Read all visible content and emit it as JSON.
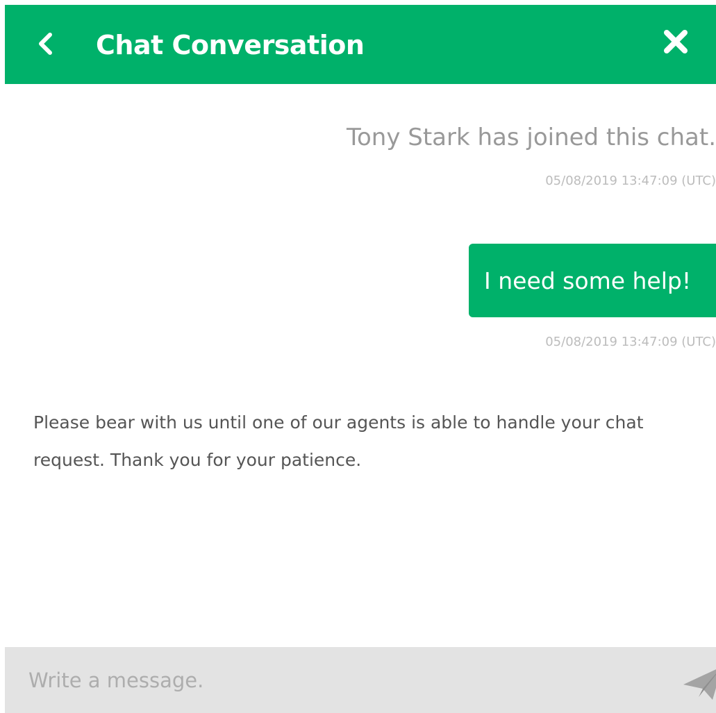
{
  "theme": {
    "accent": "#00b16a",
    "composer_bg": "#e3e3e3",
    "muted_text": "#999999"
  },
  "header": {
    "title": "Chat Conversation",
    "back_icon": "chevron-left-icon",
    "close_icon": "close-icon"
  },
  "messages": [
    {
      "type": "system",
      "text": "Tony Stark has joined this chat.",
      "timestamp": "05/08/2019 13:47:09 (UTC)"
    },
    {
      "type": "outgoing",
      "text": "I need some help!",
      "timestamp": "05/08/2019 13:47:09 (UTC)"
    }
  ],
  "notice": "Please bear with us until one of our agents is able to handle your chat request. Thank you for your patience.",
  "composer": {
    "placeholder": "Write a message.",
    "value": "",
    "send_icon": "send-icon"
  }
}
